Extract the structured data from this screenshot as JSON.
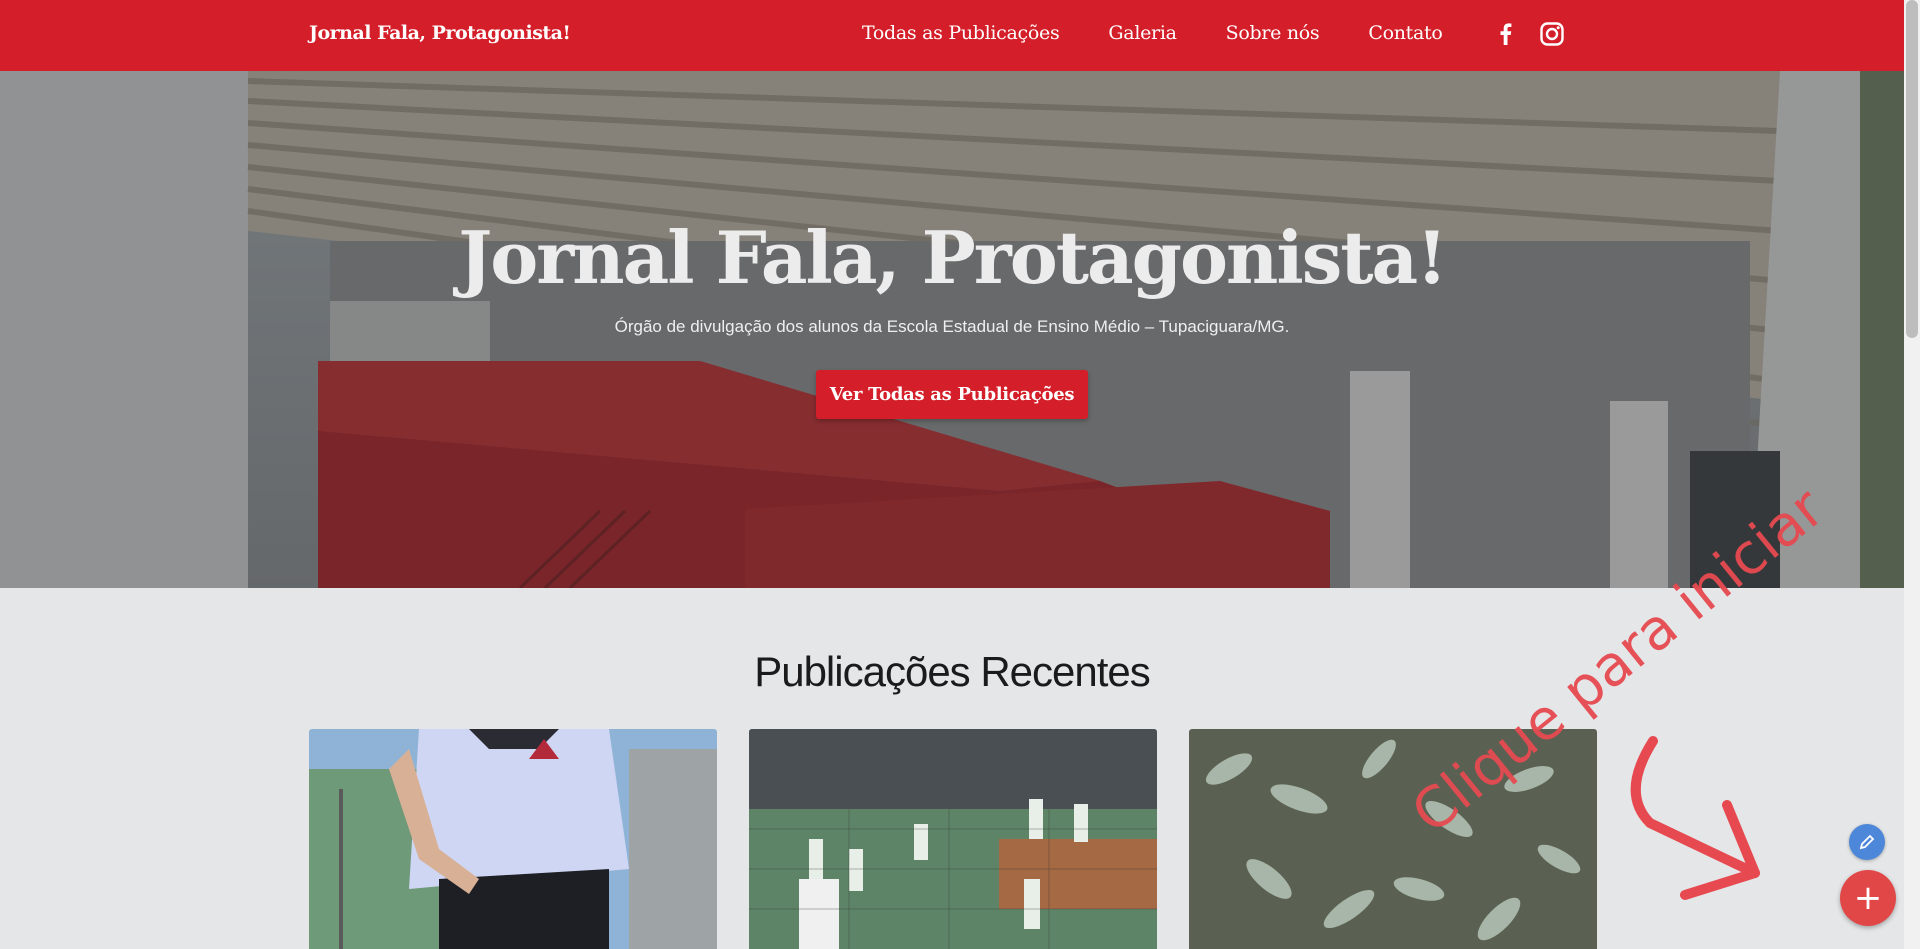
{
  "colors": {
    "brand_red": "#d41f2a",
    "page_bg": "#e4e6e8",
    "hint_red": "#e64a50",
    "edit_blue": "#4c87d9"
  },
  "navbar": {
    "brand": "Jornal Fala, Protagonista!",
    "links": [
      "Todas as Publicações",
      "Galeria",
      "Sobre nós",
      "Contato"
    ],
    "social_icons": [
      "facebook-icon",
      "instagram-icon"
    ]
  },
  "hero": {
    "title": "Jornal Fala, Protagonista!",
    "subtitle": "Órgão de divulgação dos alunos da Escola Estadual de Ensino Médio – Tupaciguara/MG.",
    "button": "Ver Todas as Publicações"
  },
  "recent": {
    "title": "Publicações Recentes",
    "cards": [
      {
        "image": "student-uniform-photo"
      },
      {
        "image": "futsal-match-photo"
      },
      {
        "image": "plant-leaves-photo"
      }
    ]
  },
  "editor": {
    "hint": "Clique para iniciar",
    "edit_icon": "pencil-icon",
    "add_label": "+"
  }
}
